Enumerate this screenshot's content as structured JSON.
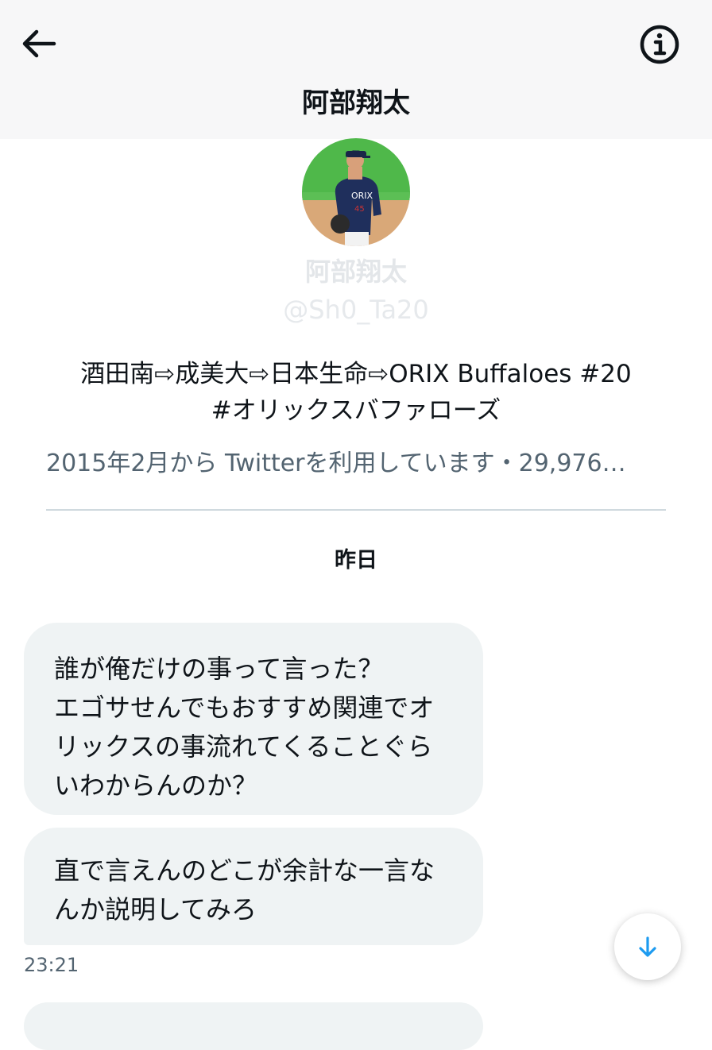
{
  "header": {
    "title": "阿部翔太",
    "back_icon": "arrow-left-icon",
    "info_icon": "info-icon"
  },
  "profile": {
    "name": "阿部翔太",
    "handle": "@Sh0_Ta20",
    "bio_line1": "酒田南⇨成美大⇨日本生命⇨ORIX Buffaloes #20",
    "bio_line2": "#オリックスバファローズ",
    "meta": "2015年2月から Twitterを利用しています・29,976…"
  },
  "conversation": {
    "date_separator": "昨日",
    "messages": [
      {
        "text": "誰が俺だけの事って言った？\nエゴサせんでもおすすめ関連でオリックスの事流れてくることぐらいわからんのか？"
      },
      {
        "text": "直で言えんのどこが余計な一言なんか説明してみろ"
      }
    ],
    "timestamp": "23:21"
  },
  "scroll_button": {
    "icon": "arrow-down-icon"
  },
  "colors": {
    "bubble": "#eff3f4",
    "accent": "#1d9bf0",
    "muted": "#536471",
    "header_bg": "#f7f7f8"
  }
}
